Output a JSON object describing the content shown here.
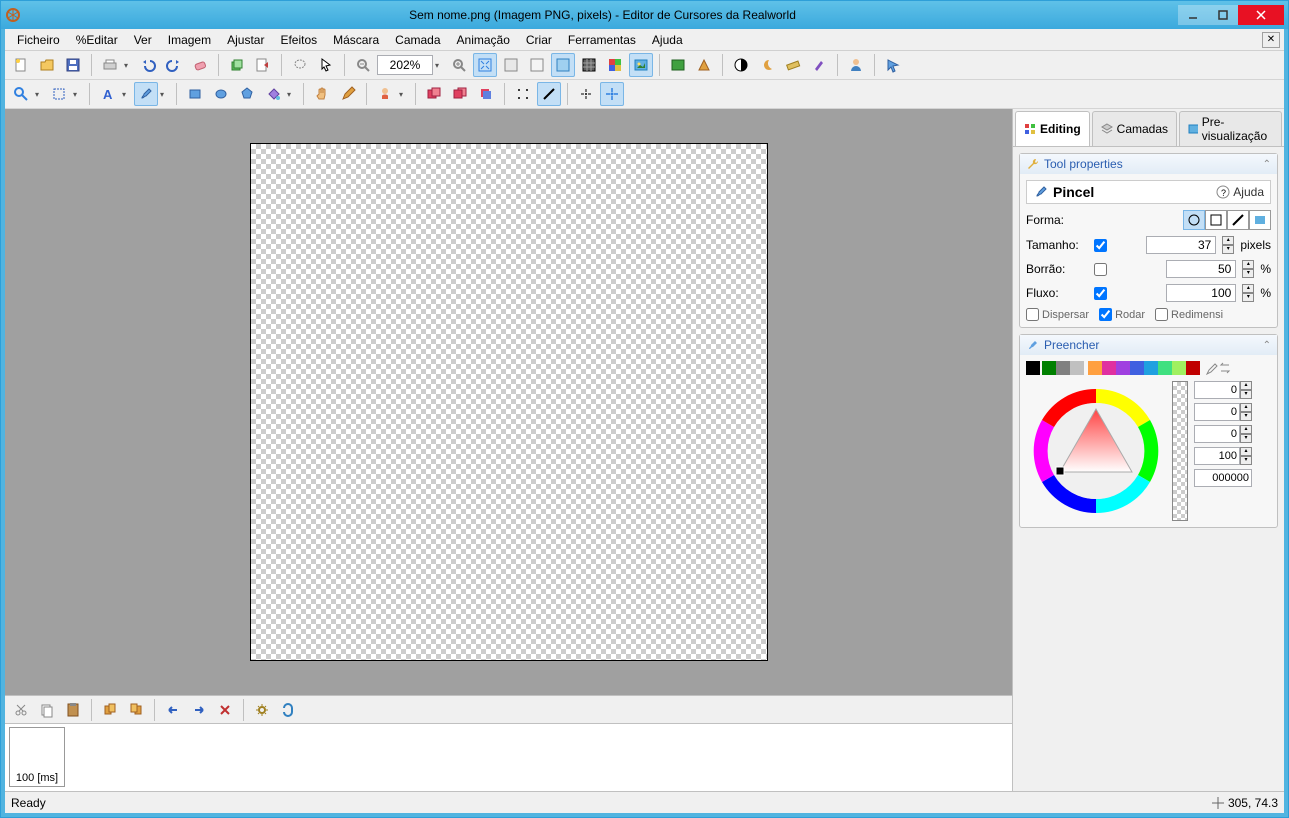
{
  "window": {
    "title": "Sem nome.png (Imagem PNG, pixels) - Editor de Cursores da Realworld"
  },
  "menu": {
    "items": [
      "Ficheiro",
      "%Editar",
      "Ver",
      "Imagem",
      "Ajustar",
      "Efeitos",
      "Máscara",
      "Camada",
      "Animação",
      "Criar",
      "Ferramentas",
      "Ajuda"
    ]
  },
  "toolbar": {
    "zoom": "202%"
  },
  "side": {
    "tabs": {
      "editing": "Editing",
      "layers": "Camadas",
      "preview": "Pre-visualização"
    },
    "tool_properties_title": "Tool properties",
    "tool_name": "Pincel",
    "help_label": "Ajuda",
    "forma_label": "Forma:",
    "tamanho_label": "Tamanho:",
    "tamanho_value": "37",
    "tamanho_unit": "pixels",
    "borrao_label": "Borrão:",
    "borrao_value": "50",
    "borrao_unit": "%",
    "fluxo_label": "Fluxo:",
    "fluxo_value": "100",
    "fluxo_unit": "%",
    "dispersar": "Dispersar",
    "rodar": "Rodar",
    "redimensi": "Redimensi",
    "preencher_title": "Preencher",
    "color_r": "0",
    "color_g": "0",
    "color_b": "0",
    "color_a": "100",
    "color_hex": "000000"
  },
  "frames": {
    "frame1": "100 [ms]"
  },
  "status": {
    "ready": "Ready",
    "coords": "305, 74.3"
  },
  "swatches": [
    "#000000",
    "#008000",
    "#808080",
    "#c0c0c0",
    "#ffa040",
    "#e030a0",
    "#a040e0",
    "#4060e0",
    "#20a0e0",
    "#40e080",
    "#a0f060",
    "#c00000"
  ]
}
